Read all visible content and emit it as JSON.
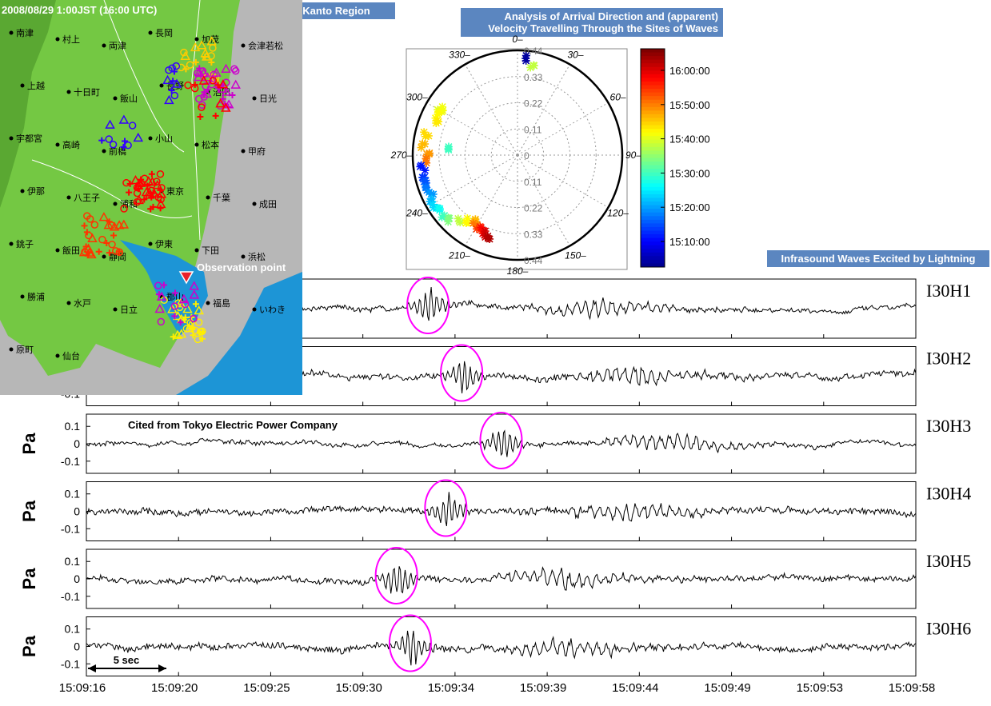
{
  "titles": {
    "map_banner": "Thunderstorms Hit the Kanto Region",
    "map_date": "2008/08/29 1:00JST (16:00 UTC)",
    "observation_label": "Observation point",
    "citation": "Cited from Tokyo Electric Power Company",
    "polar_banner_line1": "Analysis of Arrival Direction and (apparent)",
    "polar_banner_line2": "Velocity Travelling Through the Sites of Waves",
    "traces_banner": "Infrasound Waves Excited by Lightning"
  },
  "map_places": [
    "南津",
    "村上",
    "両津",
    "長岡",
    "加茂",
    "会津若松",
    "上越",
    "十日町",
    "飯山",
    "長野",
    "沼田",
    "日光",
    "宇都宮",
    "高崎",
    "前橋",
    "小山",
    "松本",
    "甲府",
    "伊那",
    "八王子",
    "浦和",
    "東京",
    "千葉",
    "成田",
    "銚子",
    "飯田",
    "静岡",
    "伊東",
    "下田",
    "浜松",
    "勝浦",
    "水戸",
    "日立",
    "郡山",
    "福島",
    "いわき",
    "原町",
    "仙台"
  ],
  "colors": {
    "circle_marker": "#ff00ff",
    "trace": "#000000",
    "banner": "#5b86c0",
    "map_sea": "#1d95d6",
    "map_land": "#74c843",
    "map_other_land": "#b7b7b7"
  },
  "colorbar": {
    "labels": [
      "16:00:00",
      "15:50:00",
      "15:40:00",
      "15:30:00",
      "15:20:00",
      "15:10:00"
    ]
  },
  "chart_data": [
    {
      "type": "scatter",
      "subtype": "polar",
      "angle_labels": [
        "0",
        "30",
        "60",
        "90",
        "120",
        "150",
        "180",
        "210",
        "240",
        "270",
        "300",
        "330"
      ],
      "radial_labels": [
        "0.44",
        "0.33",
        "0.22",
        "0.11",
        "0",
        "0.11",
        "0.22",
        "0.33",
        "0.44"
      ],
      "rmax": 0.44,
      "points": [
        {
          "theta": 4,
          "r": 0.41,
          "t": "15:05"
        },
        {
          "theta": 10,
          "r": 0.38,
          "t": "15:38"
        },
        {
          "theta": 299,
          "r": 0.37,
          "t": "15:40"
        },
        {
          "theta": 302,
          "r": 0.36,
          "t": "15:41"
        },
        {
          "theta": 296,
          "r": 0.38,
          "t": "15:42"
        },
        {
          "theta": 291,
          "r": 0.37,
          "t": "15:43"
        },
        {
          "theta": 283,
          "r": 0.39,
          "t": "15:44"
        },
        {
          "theta": 276,
          "r": 0.4,
          "t": "15:46"
        },
        {
          "theta": 272,
          "r": 0.38,
          "t": "15:48"
        },
        {
          "theta": 267,
          "r": 0.39,
          "t": "15:50"
        },
        {
          "theta": 275,
          "r": 0.3,
          "t": "15:30"
        },
        {
          "theta": 262,
          "r": 0.4,
          "t": "15:12"
        },
        {
          "theta": 258,
          "r": 0.41,
          "t": "15:14"
        },
        {
          "theta": 254,
          "r": 0.4,
          "t": "15:16"
        },
        {
          "theta": 250,
          "r": 0.41,
          "t": "15:18"
        },
        {
          "theta": 246,
          "r": 0.4,
          "t": "15:20"
        },
        {
          "theta": 242,
          "r": 0.41,
          "t": "15:22"
        },
        {
          "theta": 238,
          "r": 0.41,
          "t": "15:24"
        },
        {
          "theta": 234,
          "r": 0.4,
          "t": "15:27"
        },
        {
          "theta": 230,
          "r": 0.4,
          "t": "15:30"
        },
        {
          "theta": 226,
          "r": 0.39,
          "t": "15:34"
        },
        {
          "theta": 222,
          "r": 0.37,
          "t": "15:38"
        },
        {
          "theta": 218,
          "r": 0.35,
          "t": "15:42"
        },
        {
          "theta": 214,
          "r": 0.34,
          "t": "15:46"
        },
        {
          "theta": 211,
          "r": 0.34,
          "t": "15:50"
        },
        {
          "theta": 208,
          "r": 0.35,
          "t": "15:54"
        },
        {
          "theta": 205,
          "r": 0.35,
          "t": "15:57"
        },
        {
          "theta": 203,
          "r": 0.36,
          "t": "16:00"
        },
        {
          "theta": 200,
          "r": 0.37,
          "t": "16:02"
        }
      ]
    },
    {
      "type": "line",
      "x_ticks": [
        "15:09:16",
        "15:09:20",
        "15:09:25",
        "15:09:30",
        "15:09:34",
        "15:09:39",
        "15:09:44",
        "15:09:49",
        "15:09:53",
        "15:09:58"
      ],
      "x_range_s": [
        0,
        42
      ],
      "ylabel": "Pa",
      "y_ticks": [
        "0.1",
        "0",
        "-0.1"
      ],
      "ylim": [
        -0.17,
        0.17
      ],
      "scale_bar": "5 sec",
      "series": [
        {
          "name": "I30H1",
          "burst_s": 17.1,
          "event_s": 23.4,
          "noise": 0.012
        },
        {
          "name": "I30H2",
          "burst_s": 18.8,
          "event_s": 25.4,
          "noise": 0.015
        },
        {
          "name": "I30H3",
          "burst_s": 20.8,
          "event_s": 27.2,
          "noise": 0.01
        },
        {
          "name": "I30H4",
          "burst_s": 18.0,
          "event_s": 25.0,
          "noise": 0.016
        },
        {
          "name": "I30H5",
          "burst_s": 15.5,
          "event_s": 21.7,
          "noise": 0.014
        },
        {
          "name": "I30H6",
          "burst_s": 16.2,
          "event_s": 22.2,
          "noise": 0.016
        }
      ]
    }
  ]
}
